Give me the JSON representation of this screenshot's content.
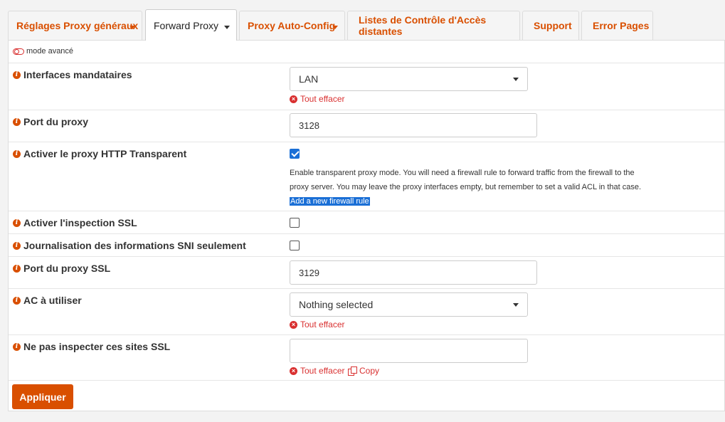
{
  "tabs": [
    {
      "label": "Réglages Proxy généraux",
      "dropdown": true
    },
    {
      "label": "Forward Proxy",
      "dropdown": true,
      "active": true
    },
    {
      "label": "Proxy Auto-Config",
      "dropdown": true
    },
    {
      "label": "Listes de Contrôle d'Accès distantes",
      "dropdown": false
    },
    {
      "label": "Support",
      "dropdown": false
    },
    {
      "label": "Error Pages",
      "dropdown": false
    }
  ],
  "advanced_mode": "mode avancé",
  "fields": {
    "interfaces": {
      "label": "Interfaces mandataires",
      "value": "LAN",
      "clear": "Tout effacer"
    },
    "port": {
      "label": "Port du proxy",
      "value": "3128"
    },
    "transparent": {
      "label": "Activer le proxy HTTP Transparent",
      "checked": true,
      "help_line1": "Enable transparent proxy mode. You will need a firewall rule to forward traffic from the firewall to the",
      "help_line2": "proxy server. You may leave the proxy interfaces empty, but remember to set a valid ACL in that case.",
      "help_link": "Add a new firewall rule"
    },
    "ssl_inspection": {
      "label": "Activer l'inspection SSL",
      "checked": false
    },
    "sni_only": {
      "label": "Journalisation des informations SNI seulement",
      "checked": false
    },
    "ssl_port": {
      "label": "Port du proxy SSL",
      "value": "3129"
    },
    "ca": {
      "label": "AC à utiliser",
      "value": "Nothing selected",
      "clear": "Tout effacer"
    },
    "no_inspect": {
      "label": "Ne pas inspecter ces sites SSL",
      "value": "",
      "clear": "Tout effacer",
      "copy": "Copy"
    }
  },
  "apply_label": "Appliquer",
  "colors": {
    "accent": "#d94f00",
    "danger": "#d93030",
    "checkbox": "#1a6fd6"
  }
}
